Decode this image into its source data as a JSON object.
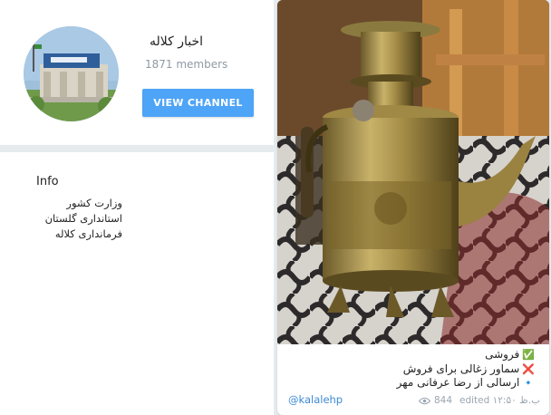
{
  "channel": {
    "title": "اخبار کلاله",
    "members": "1871 members",
    "view_button": "VIEW CHANNEL"
  },
  "info": {
    "heading": "Info",
    "lines": [
      "وزارت کشور",
      "استانداری گلستان",
      "فرمانداری کلاله"
    ]
  },
  "post": {
    "caption": [
      {
        "icon": "check-icon",
        "symbol": "✅",
        "color": "#5fbf3a",
        "text": "فروشی"
      },
      {
        "icon": "cross-icon",
        "symbol": "❌",
        "color": "#e34b4b",
        "text": "سماور زغالی برای فروش"
      },
      {
        "icon": "diamond-icon",
        "symbol": "🔹",
        "color": "#3d8ad4",
        "text": "ارسالی از رضا عرفانی مهر"
      }
    ],
    "signature": "@kalalehp",
    "views": "844",
    "edited": "edited ۱۲:۵۰ ب.ظ"
  },
  "colors": {
    "accent": "#4ea4f6",
    "link": "#3d8ad4",
    "muted": "#8e9aa3"
  }
}
